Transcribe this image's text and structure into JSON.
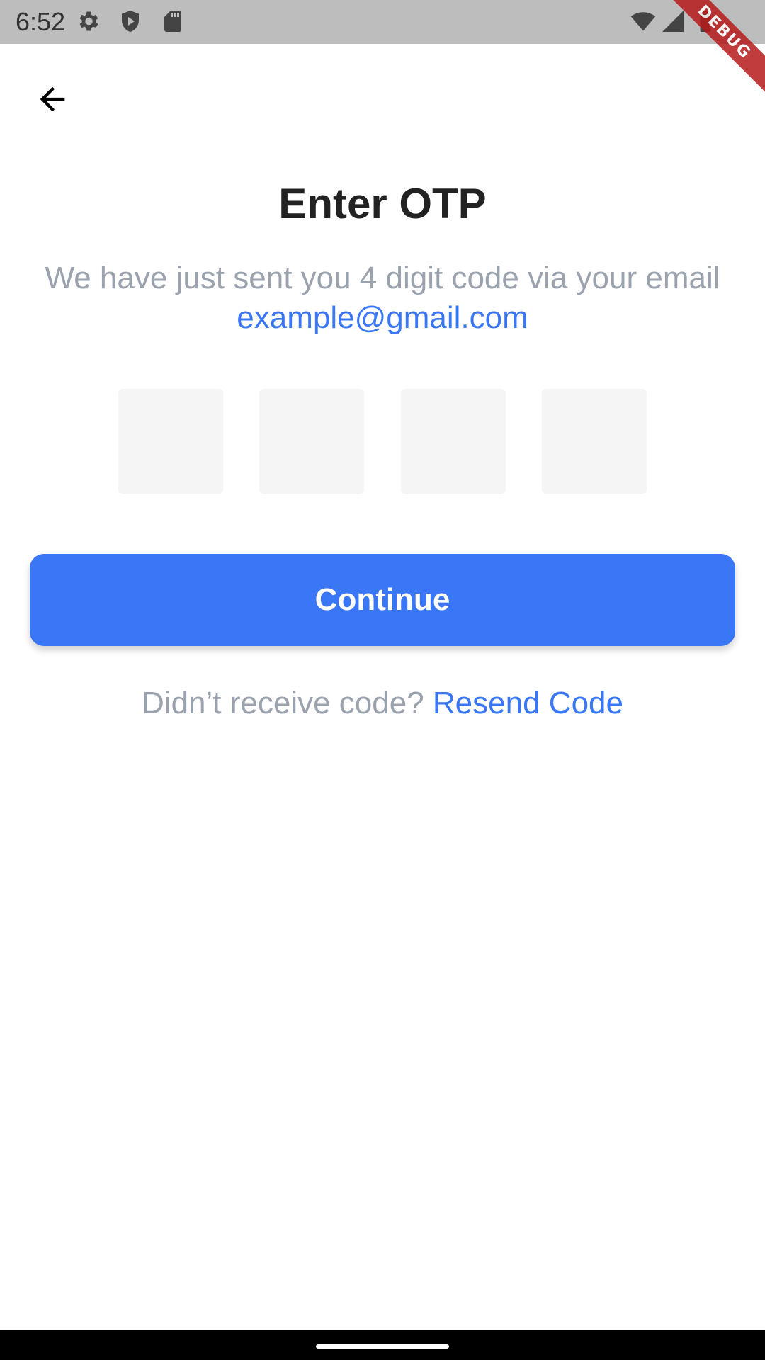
{
  "status_bar": {
    "time": "6:52",
    "icons": [
      "settings-icon",
      "shield-play-icon",
      "sd-card-icon",
      "wifi-icon",
      "signal-icon",
      "battery-icon"
    ]
  },
  "debug_banner": {
    "label": "DEBUG"
  },
  "header": {
    "back_icon": "arrow-back-icon"
  },
  "main": {
    "title": "Enter OTP",
    "subtitle_text": "We have just sent you 4 digit code via your email ",
    "email": "example@gmail.com",
    "otp_digits": [
      "",
      "",
      "",
      ""
    ],
    "continue_label": "Continue",
    "resend_prompt": "Didn’t receive code? ",
    "resend_link": "Resend Code"
  },
  "colors": {
    "accent": "#3a77f6",
    "muted_text": "#9aa2ad",
    "title_text": "#222222",
    "otp_box_bg": "#f5f5f5",
    "status_bar_bg": "#bdbdbd"
  }
}
